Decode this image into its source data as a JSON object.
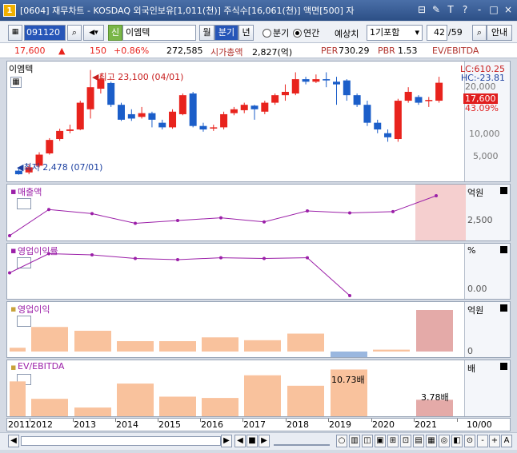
{
  "window": {
    "title": "[0604] 재무차트 - KOSDAQ 외국인보유[1,011(천)] 주식수[16,061(천)] 액면[500] 자",
    "logo": "1",
    "controls": [
      "⊟",
      "✎",
      "T",
      "?",
      "-",
      "□",
      "×"
    ]
  },
  "toolbar": {
    "code": "091120",
    "name_badge": "신",
    "name": "이엠텍",
    "tabs": [
      "월",
      "분기",
      "년"
    ],
    "active_tab": "분기",
    "radio_quarter": "분기",
    "radio_annual": "연간",
    "forecast_label": "예상치",
    "forecast_value": "1기포함",
    "page": "42",
    "page_total": "/59",
    "guide": "안내"
  },
  "infobar": {
    "price": "17,600",
    "change": "150",
    "change_pct": "+0.86%",
    "volume": "272,585",
    "mcap_label": "시가총액",
    "mcap_value": "2,827(억)",
    "per_label": "PER",
    "per_value": "730.29",
    "pbr_label": "PBR",
    "pbr_value": "1.53",
    "evebitda": "EV/EBITDA"
  },
  "colors": {
    "up": "#e8231d",
    "down": "#1b5ec9",
    "purple": "#9b1fa8",
    "bar": "#f9c29d",
    "bar_neg": "#9ab7df",
    "highlight": "#f5cfcf"
  },
  "price_panel": {
    "label": "이엠텍",
    "high_note": "최고 23,100 (04/01)",
    "low_note": "최저 2,478 (07/01)",
    "lc": "LC:610.25",
    "hc": "HC:-23.81",
    "price_tag": "17,600",
    "price_pct": "43.09%",
    "yticks": [
      "20,000",
      "10,000",
      "5,000"
    ],
    "candles": [
      {
        "o": 2700,
        "c": 2500,
        "h": 2900,
        "l": 2478
      },
      {
        "o": 2600,
        "c": 2900,
        "h": 3100,
        "l": 2500
      },
      {
        "o": 3000,
        "c": 3800,
        "h": 4000,
        "l": 2900
      },
      {
        "o": 3900,
        "c": 5200,
        "h": 5400,
        "l": 3800
      },
      {
        "o": 5300,
        "c": 6300,
        "h": 6600,
        "l": 5100
      },
      {
        "o": 6300,
        "c": 6500,
        "h": 7200,
        "l": 6000
      },
      {
        "o": 6500,
        "c": 11500,
        "h": 12000,
        "l": 6400
      },
      {
        "o": 10000,
        "c": 16000,
        "h": 23100,
        "l": 8200
      },
      {
        "o": 15500,
        "c": 19000,
        "h": 21000,
        "l": 14000
      },
      {
        "o": 17500,
        "c": 11000,
        "h": 18000,
        "l": 10500
      },
      {
        "o": 11000,
        "c": 8000,
        "h": 11500,
        "l": 7800
      },
      {
        "o": 9000,
        "c": 8200,
        "h": 10000,
        "l": 7800
      },
      {
        "o": 8500,
        "c": 9200,
        "h": 10500,
        "l": 8200
      },
      {
        "o": 9200,
        "c": 8000,
        "h": 9500,
        "l": 6800
      },
      {
        "o": 7500,
        "c": 6800,
        "h": 8000,
        "l": 6500
      },
      {
        "o": 6800,
        "c": 9500,
        "h": 10000,
        "l": 6600
      },
      {
        "o": 9000,
        "c": 13500,
        "h": 14000,
        "l": 8800
      },
      {
        "o": 14000,
        "c": 7000,
        "h": 14500,
        "l": 6800
      },
      {
        "o": 7000,
        "c": 6500,
        "h": 7500,
        "l": 6200
      },
      {
        "o": 6800,
        "c": 6800,
        "h": 7200,
        "l": 6300
      },
      {
        "o": 6800,
        "c": 9000,
        "h": 9500,
        "l": 6500
      },
      {
        "o": 9200,
        "c": 10000,
        "h": 10500,
        "l": 8800
      },
      {
        "o": 9800,
        "c": 11000,
        "h": 11500,
        "l": 9200
      },
      {
        "o": 10800,
        "c": 10000,
        "h": 11000,
        "l": 8000
      },
      {
        "o": 9500,
        "c": 11500,
        "h": 12000,
        "l": 9000
      },
      {
        "o": 11500,
        "c": 13500,
        "h": 14000,
        "l": 11000
      },
      {
        "o": 13500,
        "c": 14500,
        "h": 17000,
        "l": 12000
      },
      {
        "o": 14000,
        "c": 19000,
        "h": 22000,
        "l": 13500
      },
      {
        "o": 19000,
        "c": 18000,
        "h": 20000,
        "l": 17000
      },
      {
        "o": 18000,
        "c": 19000,
        "h": 21000,
        "l": 17500
      },
      {
        "o": 19000,
        "c": 18500,
        "h": 22000,
        "l": 16000
      },
      {
        "o": 18000,
        "c": 17000,
        "h": 20000,
        "l": 11000
      },
      {
        "o": 18500,
        "c": 13500,
        "h": 19000,
        "l": 12000
      },
      {
        "o": 13500,
        "c": 11000,
        "h": 14000,
        "l": 10500
      },
      {
        "o": 11000,
        "c": 7500,
        "h": 12000,
        "l": 7000
      },
      {
        "o": 7500,
        "c": 6500,
        "h": 8000,
        "l": 6000
      },
      {
        "o": 6000,
        "c": 5500,
        "h": 6500,
        "l": 5000
      },
      {
        "o": 5300,
        "c": 12000,
        "h": 12500,
        "l": 5000
      },
      {
        "o": 12000,
        "c": 14500,
        "h": 16000,
        "l": 11500
      },
      {
        "o": 13000,
        "c": 11500,
        "h": 13500,
        "l": 11000
      },
      {
        "o": 12000,
        "c": 12200,
        "h": 13000,
        "l": 10500
      },
      {
        "o": 12000,
        "c": 17600,
        "h": 20000,
        "l": 11500
      }
    ]
  },
  "sales_panel": {
    "label": "매출액",
    "unit": "억원",
    "ytick": "2,500",
    "values": [
      1050,
      2950,
      2650,
      1950,
      2150,
      2350,
      2050,
      2850,
      2700,
      2800,
      3950
    ]
  },
  "margin_panel": {
    "label": "영업이익률",
    "unit": "%",
    "ytick": "0.00",
    "values": [
      5.5,
      13.5,
      13.0,
      11.5,
      11.0,
      11.8,
      11.5,
      11.8,
      -4.0
    ]
  },
  "op_panel": {
    "label": "영업이익",
    "unit": "억원",
    "ytick": "0",
    "values": [
      20,
      130,
      110,
      55,
      55,
      75,
      60,
      95,
      -30,
      10,
      220
    ]
  },
  "ev_panel": {
    "label": "EV/EBITDA",
    "unit": "배",
    "label_2019": "10.73배",
    "label_2021": "3.78배",
    "values": [
      8.0,
      4.0,
      2.0,
      7.5,
      4.5,
      4.2,
      9.4,
      7.0,
      10.73,
      0,
      3.78
    ]
  },
  "xaxis": {
    "labels": [
      "2011",
      "2012",
      "2013",
      "2014",
      "2015",
      "2016",
      "2017",
      "2018",
      "2019",
      "2020",
      "2021",
      "10/00"
    ]
  }
}
